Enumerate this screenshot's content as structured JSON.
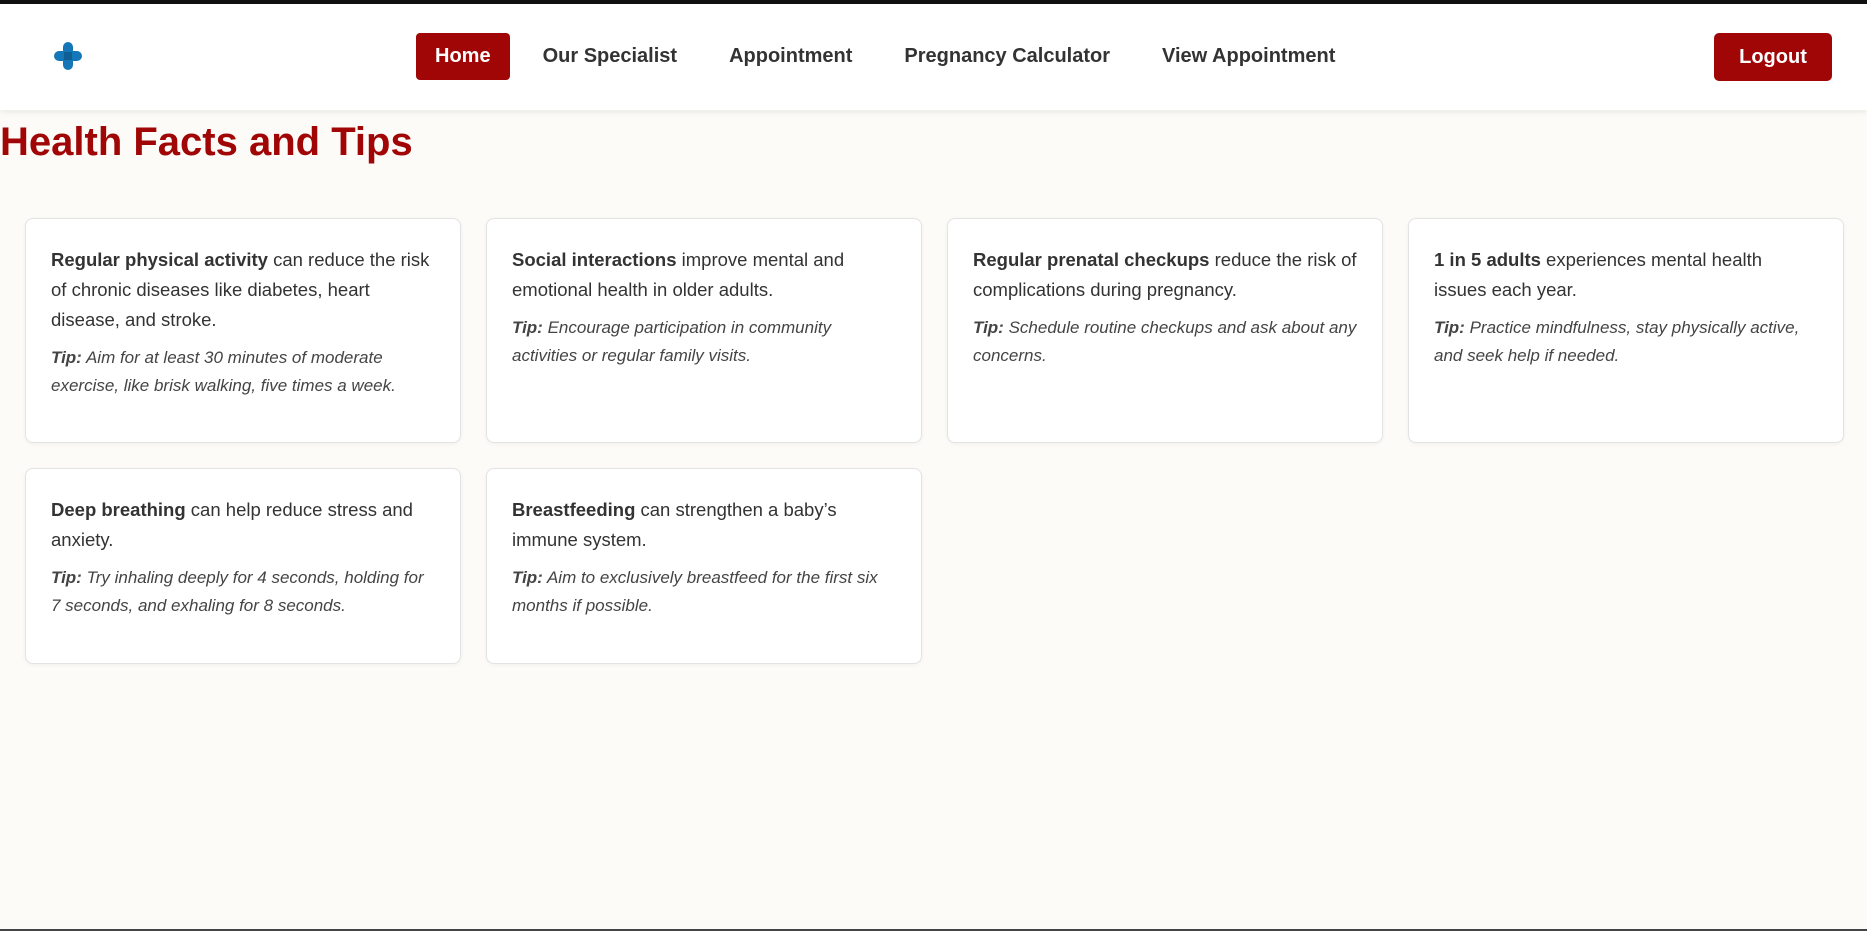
{
  "header": {
    "logo_icon": "medical-cross-icon",
    "nav": [
      {
        "label": "Home",
        "active": true
      },
      {
        "label": "Our Specialist",
        "active": false
      },
      {
        "label": "Appointment",
        "active": false
      },
      {
        "label": "Pregnancy Calculator",
        "active": false
      },
      {
        "label": "View Appointment",
        "active": false
      }
    ],
    "logout_label": "Logout"
  },
  "page": {
    "title": "Health Facts and Tips"
  },
  "cards": [
    {
      "highlight": "Regular physical activity",
      "text": " can reduce the risk of chronic diseases like diabetes, heart disease, and stroke.",
      "tip_label": "Tip:",
      "tip": " Aim for at least 30 minutes of moderate exercise, like brisk walking, five times a week."
    },
    {
      "highlight": "Social interactions",
      "text": " improve mental and emotional health in older adults.",
      "tip_label": "Tip:",
      "tip": " Encourage participation in community activities or regular family visits."
    },
    {
      "highlight": "Regular prenatal checkups",
      "text": " reduce the risk of complications during pregnancy.",
      "tip_label": "Tip:",
      "tip": " Schedule routine checkups and ask about any concerns."
    },
    {
      "highlight": "1 in 5 adults",
      "text": " experiences mental health issues each year.",
      "tip_label": "Tip:",
      "tip": " Practice mindfulness, stay physically active, and seek help if needed."
    },
    {
      "highlight": "Deep breathing",
      "text": " can help reduce stress and anxiety.",
      "tip_label": "Tip:",
      "tip": " Try inhaling deeply for 4 seconds, holding for 7 seconds, and exhaling for 8 seconds."
    },
    {
      "highlight": "Breastfeeding",
      "text": " can strengthen a baby’s immune system.",
      "tip_label": "Tip:",
      "tip": " Aim to exclusively breastfeed for the first six months if possible."
    }
  ],
  "colors": {
    "brand": "#a10606",
    "logo_blue": "#1677b8",
    "background": "#fcfbf7"
  }
}
